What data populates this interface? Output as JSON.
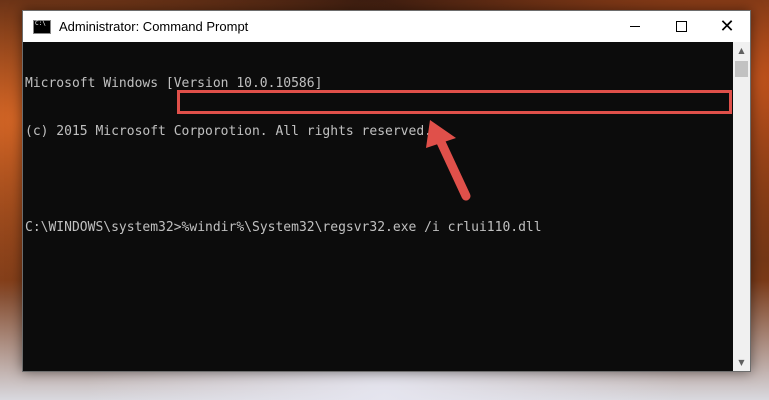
{
  "window": {
    "title": "Administrator: Command Prompt",
    "controls": {
      "minimize": "minimize",
      "maximize": "maximize",
      "close": "✕"
    }
  },
  "console": {
    "lines": [
      "Microsoft Windows [Version 10.0.10586]",
      "(c) 2015 Microsoft Corporotion. All rights reserved.",
      ""
    ],
    "prompt": "C:\\WINDOWS\\system32>",
    "command": "%windir%\\System32\\regsvr32.exe /i crlui110.dll"
  },
  "scrollbar": {
    "up": "▲",
    "down": "▼"
  },
  "annotation": {
    "highlight_color": "#e0504a",
    "arrow_color": "#e0504a"
  }
}
